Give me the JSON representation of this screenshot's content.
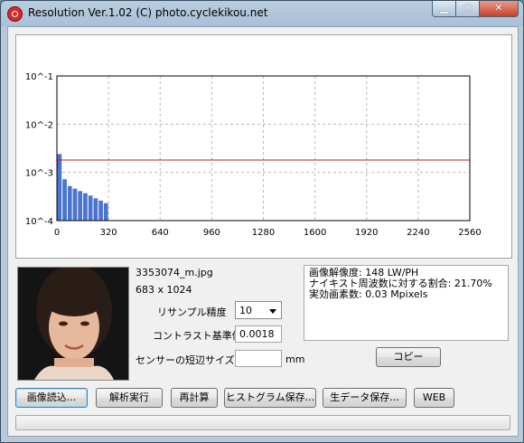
{
  "window": {
    "title": "Resolution Ver.1.02 (C) photo.cyclekikou.net"
  },
  "chart_data": {
    "type": "bar",
    "x_ticks": [
      "0",
      "320",
      "640",
      "960",
      "1280",
      "1600",
      "1920",
      "2240",
      "2560"
    ],
    "y_ticks": [
      "10^-1",
      "10^-2",
      "10^-3",
      "10^-4"
    ],
    "xlim": [
      0,
      2560
    ],
    "ylim_log10": [
      -4,
      -1
    ],
    "y_scale": "log",
    "grid": true,
    "bars": {
      "x": [
        0,
        32,
        64,
        96,
        128,
        160,
        192,
        224,
        256,
        288
      ],
      "width": 32,
      "values": [
        0.0024,
        0.00072,
        0.00052,
        0.00046,
        0.00041,
        0.00037,
        0.00033,
        0.00029,
        0.00026,
        0.00023
      ],
      "color": "#4a74d0"
    },
    "threshold": {
      "value": 0.0018,
      "color": "#c41e1e"
    }
  },
  "file": {
    "name": "3353074_m.jpg",
    "dims": "683 x 1024"
  },
  "params": {
    "sampling_label": "リサンプル精度",
    "sampling_value": "10",
    "contrast_label": "コントラスト基準値",
    "contrast_value": "0.0018",
    "sensor_label": "センサーの短辺サイズ",
    "sensor_value": "",
    "sensor_unit": "mm"
  },
  "info": {
    "line1": "画像解像度: 148 LW/PH",
    "line2": "ナイキスト周波数に対する割合: 21.70%",
    "line3": "実効画素数: 0.03 Mpixels"
  },
  "buttons": {
    "copy": "コピー",
    "load": "画像読込...",
    "analyze": "解析実行",
    "recalc": "再計算",
    "save_hist": "ヒストグラム保存...",
    "save_raw": "生データ保存...",
    "web": "WEB"
  },
  "icons": {
    "app": "app-logo-icon",
    "minimize": "minimize-icon",
    "maximize": "maximize-icon",
    "close": "close-icon"
  }
}
